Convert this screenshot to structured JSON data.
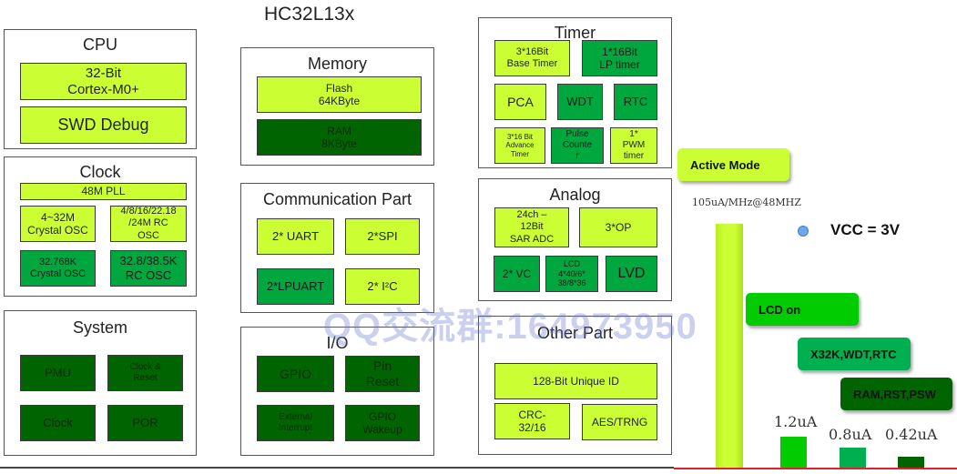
{
  "title": "HC32L13x",
  "watermark": "QQ交流群:164973950",
  "panels": {
    "cpu": {
      "title": "CPU",
      "blocks": [
        "32-Bit\nCortex-M0+",
        "SWD Debug"
      ]
    },
    "clock": {
      "title": "Clock",
      "blocks": [
        "48M PLL",
        "4~32M\nCrystal OSC",
        "4/8/16/22.18\n/24M RC\nOSC",
        "32.768K\nCrystal OSC",
        "32.8/38.5K\nRC OSC"
      ]
    },
    "system": {
      "title": "System",
      "blocks": [
        "PMU",
        "Clock &\nReset",
        "Clock",
        "POR"
      ]
    },
    "memory": {
      "title": "Memory",
      "blocks": [
        "Flash\n64KByte",
        "RAM\n8KByte"
      ]
    },
    "communication": {
      "title": "Communication Part",
      "blocks": [
        "2* UART",
        "2*SPI",
        "2*LPUART",
        "2* I²C"
      ]
    },
    "io": {
      "title": "I/O",
      "blocks": [
        "GPIO",
        "Pin\nReset",
        "External\nInterrupt",
        "GPIO\nWakeup"
      ]
    },
    "timer": {
      "title": "Timer",
      "blocks": [
        "3*16Bit\nBase Timer",
        "1*16Bit\nLP timer",
        "PCA",
        "WDT",
        "RTC",
        "3*16 Bit\nAdvance\nTimer",
        "Pulse\nCounte\nr",
        "1*\nPWM\ntimer"
      ]
    },
    "analog": {
      "title": "Analog",
      "blocks": [
        "24ch –\n12Bit\nSAR ADC",
        "3*OP",
        "2* VC",
        "LCD\n4*40/6*\n38/8*36",
        "LVD"
      ]
    },
    "other": {
      "title": "Other Part",
      "blocks": [
        "128-Bit Unique ID",
        "CRC-\n32/16",
        "AES/TRNG"
      ]
    }
  },
  "power": {
    "legend": "VCC = 3V",
    "active_rate": "105uA/MHz@48MHZ",
    "modes": [
      "Active Mode",
      "LCD on",
      "X32K,WDT,RTC",
      "RAM,RST,PSW"
    ],
    "colors": {
      "active": "#ccff33",
      "lcd": "#00cc00",
      "x32k": "#00b050",
      "ram": "#006400",
      "axis": "#e0202a"
    }
  },
  "chart_data": {
    "type": "bar",
    "title": "",
    "categories": [
      "Active Mode",
      "LCD on",
      "X32K,WDT,RTC",
      "RAM,RST,PSW"
    ],
    "values": [
      null,
      1.2,
      0.8,
      0.42
    ],
    "value_labels": [
      "105uA/MHz@48MHZ",
      "1.2uA",
      "0.8uA",
      "0.42uA"
    ],
    "units": "uA",
    "legend": [
      "VCC = 3V"
    ],
    "xlabel": "",
    "ylabel": ""
  }
}
